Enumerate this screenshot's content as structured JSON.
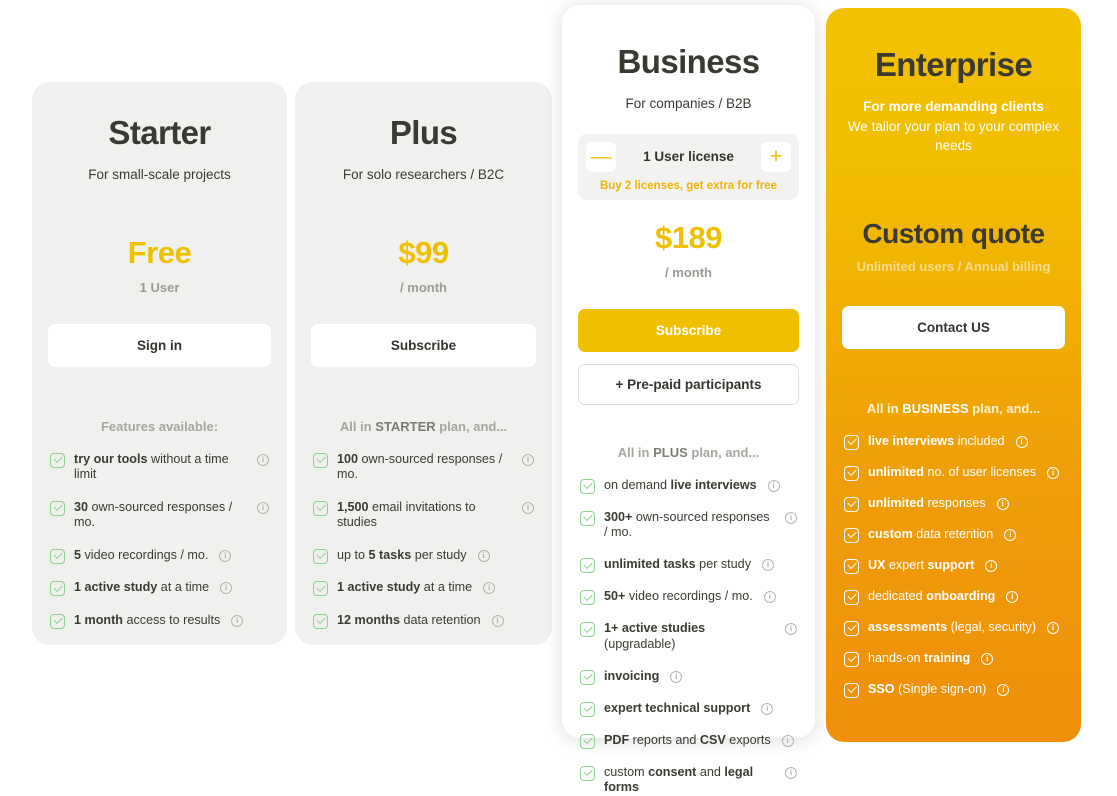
{
  "plans": [
    {
      "id": "starter",
      "title": "Starter",
      "subtitle": "For small-scale projects",
      "price": "Free",
      "price_note": "1 User",
      "cta": "Sign in",
      "features_head_plain": "Features available:",
      "features_head_strong": "",
      "features_head_tail": "",
      "features": [
        {
          "bold_first": true,
          "bold": "try our tools",
          "rest": " without a time limit"
        },
        {
          "bold_first": true,
          "bold": "30",
          "rest": " own-sourced responses / mo."
        },
        {
          "bold_first": true,
          "bold": "5",
          "rest": " video recordings / mo."
        },
        {
          "bold_first": true,
          "bold": "1 active study",
          "rest": " at a time"
        },
        {
          "bold_first": true,
          "bold": "1 month",
          "rest": " access to results"
        }
      ]
    },
    {
      "id": "plus",
      "title": "Plus",
      "subtitle": "For solo researchers / B2C",
      "price": "$99",
      "price_note": "/ month",
      "cta": "Subscribe",
      "features_head_plain": "All in ",
      "features_head_strong": "STARTER",
      "features_head_tail": " plan, and...",
      "features": [
        {
          "bold_first": true,
          "bold": "100",
          "rest": " own-sourced responses / mo."
        },
        {
          "bold_first": true,
          "bold": "1,500",
          "rest": " email invitations to studies"
        },
        {
          "bold_first": false,
          "pre": "up to ",
          "bold": "5 tasks",
          "rest": " per study"
        },
        {
          "bold_first": true,
          "bold": "1 active study",
          "rest": " at a time"
        },
        {
          "bold_first": true,
          "bold": "12 months",
          "rest": " data retention"
        }
      ]
    },
    {
      "id": "business",
      "title": "Business",
      "subtitle": "For companies / B2B",
      "license_label": "1 User license",
      "license_promo": "Buy 2 licenses, get extra for free",
      "license_minus": "—",
      "license_plus": "+",
      "price": "$189",
      "price_note": "/ month",
      "cta": "Subscribe",
      "cta_secondary": "+ Pre-paid participants",
      "features_head_plain": "All in ",
      "features_head_strong": "PLUS",
      "features_head_tail": " plan, and...",
      "features": [
        {
          "bold_first": false,
          "pre": "on demand ",
          "bold": "live interviews",
          "rest": ""
        },
        {
          "bold_first": true,
          "bold": "300+",
          "rest": " own-sourced responses / mo."
        },
        {
          "bold_first": true,
          "bold": "unlimited tasks",
          "rest": " per study"
        },
        {
          "bold_first": true,
          "bold": "50+",
          "rest": " video recordings / mo."
        },
        {
          "bold_first": true,
          "bold": "1+ active studies",
          "rest": " (upgradable)"
        },
        {
          "bold_first": true,
          "bold": "invoicing",
          "rest": ""
        },
        {
          "bold_first": true,
          "bold": "expert technical support",
          "rest": ""
        },
        {
          "bold_first": true,
          "bold": "PDF",
          "rest": " reports and ",
          "bold2": "CSV",
          "rest2": " exports"
        },
        {
          "bold_first": false,
          "pre": "custom ",
          "bold": "consent",
          "rest": " and ",
          "bold2": "legal forms",
          "rest2": ""
        }
      ]
    },
    {
      "id": "enterprise",
      "title": "Enterprise",
      "subtitle_bold": "For more demanding clients",
      "subtitle_thin": "We tailor your plan to your complex needs",
      "price": "Custom quote",
      "price_note": "Unlimited users / Annual billing",
      "cta": "Contact US",
      "features_head_plain": "All in ",
      "features_head_strong": "BUSINESS",
      "features_head_tail": " plan, and...",
      "features": [
        {
          "bold_first": true,
          "bold": "live interviews",
          "rest": " included"
        },
        {
          "bold_first": true,
          "bold": "unlimited",
          "rest": " no. of user licenses"
        },
        {
          "bold_first": true,
          "bold": "unlimited",
          "rest": " responses"
        },
        {
          "bold_first": true,
          "bold": "custom",
          "rest": " data retention"
        },
        {
          "bold_first": true,
          "bold": "UX",
          "rest": " expert ",
          "bold2": "support",
          "rest2": ""
        },
        {
          "bold_first": false,
          "pre": "dedicated ",
          "bold": "onboarding",
          "rest": ""
        },
        {
          "bold_first": true,
          "bold": "assessments",
          "rest": " (legal, security)"
        },
        {
          "bold_first": false,
          "pre": "hands-on ",
          "bold": "training",
          "rest": ""
        },
        {
          "bold_first": true,
          "bold": "SSO",
          "rest": " (Single sign-on)"
        }
      ]
    }
  ],
  "icons": {
    "info": "i",
    "check": "check-icon"
  },
  "colors": {
    "accent_yellow": "#f0c000",
    "card_grey": "#f0f0ee",
    "enterprise_top": "#f2c200",
    "enterprise_bottom": "#ef8f0b",
    "check_green": "#8fcf8f",
    "text_dark": "#3a3a32",
    "text_muted": "#a6a6a0"
  }
}
